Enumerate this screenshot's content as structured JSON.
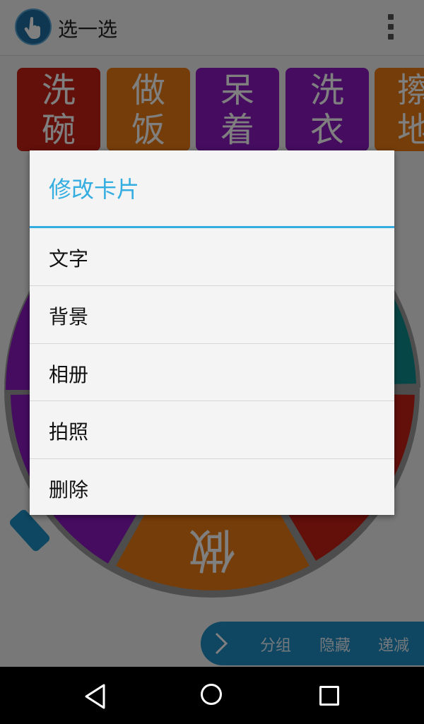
{
  "app": {
    "title": "选一选",
    "icon": "hand-pointer-icon"
  },
  "cards": [
    {
      "line1": "洗",
      "line2": "碗",
      "color": "#c61e15"
    },
    {
      "line1": "做",
      "line2": "饭",
      "color": "#ea7a12"
    },
    {
      "line1": "呆",
      "line2": "着",
      "color": "#8a18c0"
    },
    {
      "line1": "洗",
      "line2": "衣",
      "color": "#8a18c0"
    },
    {
      "line1": "擦",
      "line2": "地",
      "color": "#ea7a12"
    }
  ],
  "wheel": {
    "segment_colors": [
      "#8a18c0",
      "#ea7a12",
      "#c61e15",
      "#0e8c8c"
    ],
    "bottom_segment_label": "做"
  },
  "toolbar": {
    "buttons": [
      "分组",
      "隐藏",
      "递减"
    ],
    "color": "#1f8cc3"
  },
  "dialog": {
    "title": "修改卡片",
    "accent": "#34ade0",
    "items": [
      "文字",
      "背景",
      "相册",
      "拍照",
      "删除"
    ]
  },
  "navbar": {
    "back": "back-icon",
    "home": "home-icon",
    "recent": "recent-apps-icon"
  }
}
